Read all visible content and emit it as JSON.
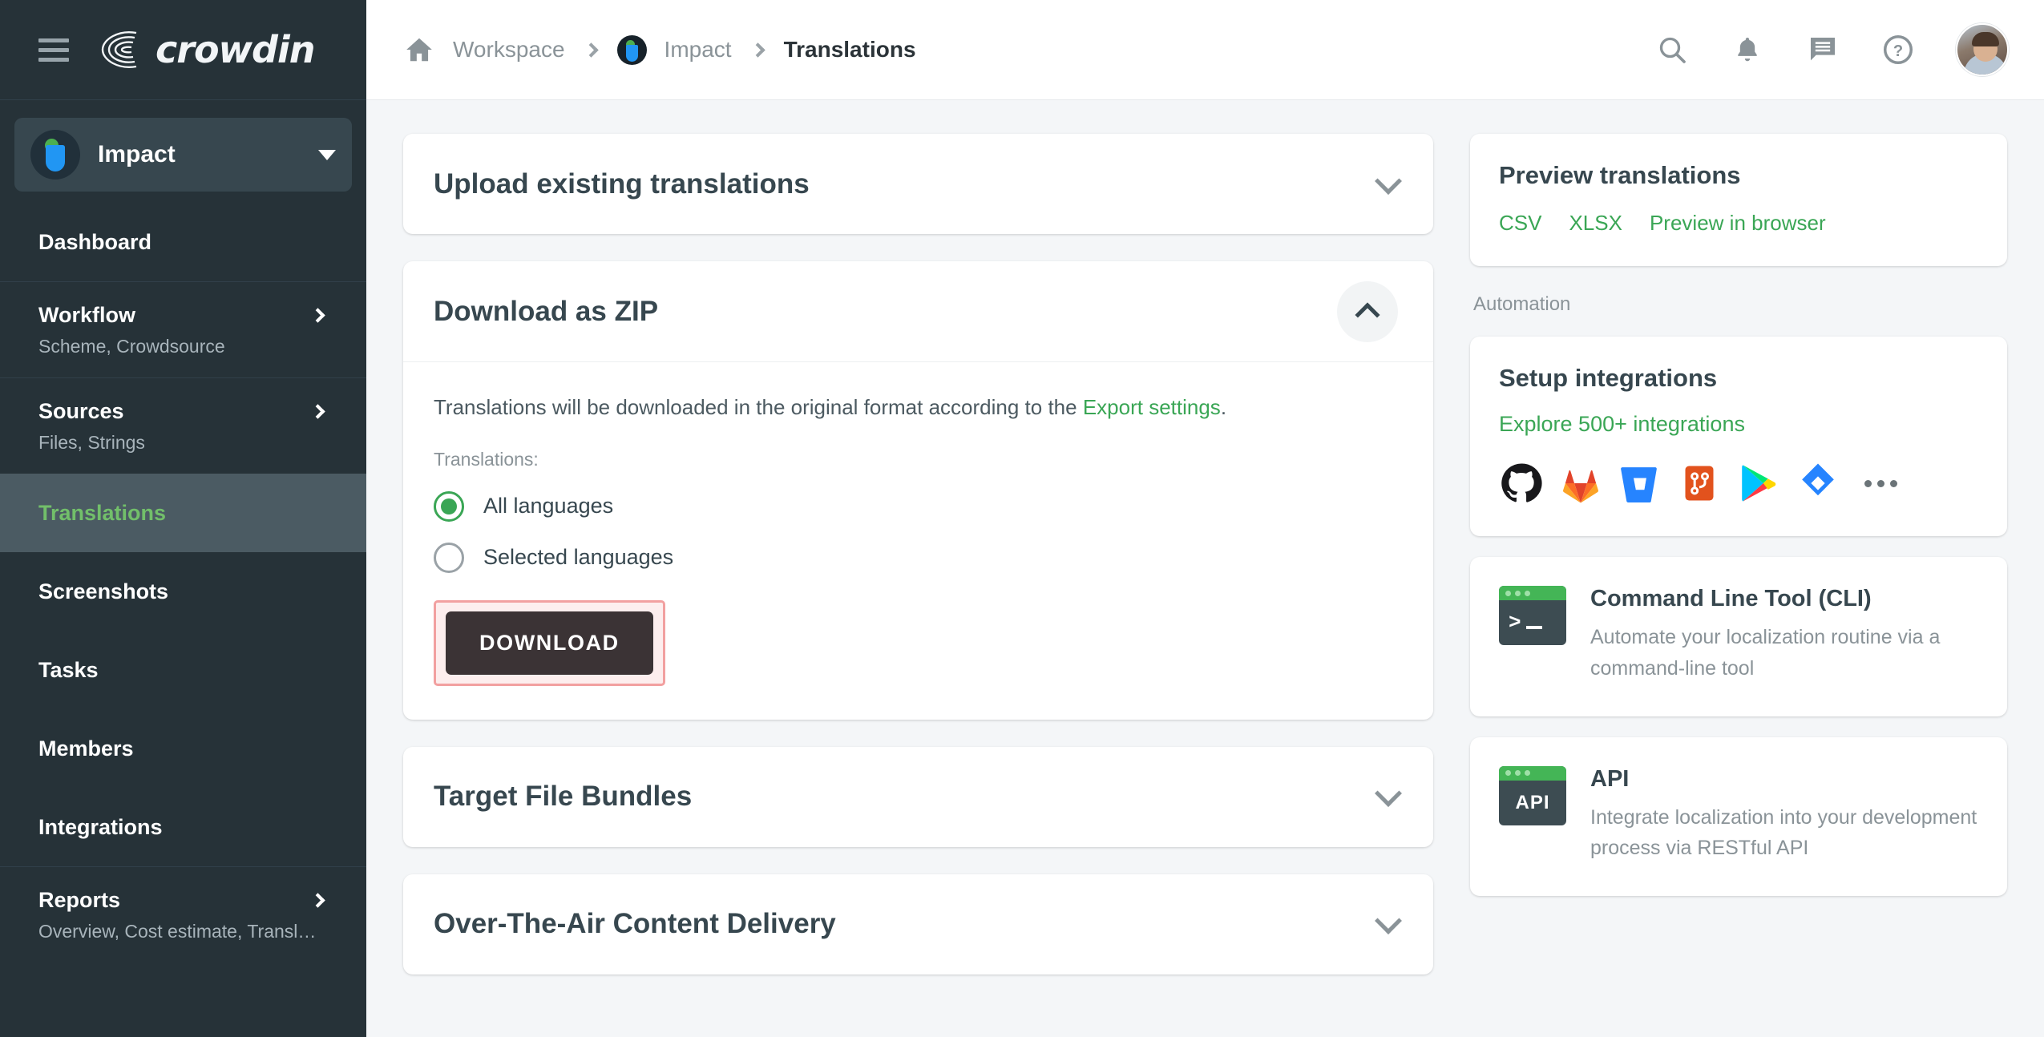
{
  "sidebar": {
    "brand": "crowdin",
    "project": {
      "name": "Impact"
    },
    "items": [
      {
        "label": "Dashboard",
        "sub": "",
        "chevron": false,
        "active": false,
        "divided": false
      },
      {
        "label": "Workflow",
        "sub": "Scheme, Crowdsource",
        "chevron": true,
        "active": false,
        "divided": true
      },
      {
        "label": "Sources",
        "sub": "Files, Strings",
        "chevron": true,
        "active": false,
        "divided": true
      },
      {
        "label": "Translations",
        "sub": "",
        "chevron": false,
        "active": true,
        "divided": false
      },
      {
        "label": "Screenshots",
        "sub": "",
        "chevron": false,
        "active": false,
        "divided": false
      },
      {
        "label": "Tasks",
        "sub": "",
        "chevron": false,
        "active": false,
        "divided": false
      },
      {
        "label": "Members",
        "sub": "",
        "chevron": false,
        "active": false,
        "divided": false
      },
      {
        "label": "Integrations",
        "sub": "",
        "chevron": false,
        "active": false,
        "divided": false
      },
      {
        "label": "Reports",
        "sub": "Overview, Cost estimate, Transl…",
        "chevron": true,
        "active": false,
        "divided": true
      }
    ]
  },
  "topbar": {
    "breadcrumb": {
      "home": "home-icon",
      "workspace": "Workspace",
      "project": "Impact",
      "current": "Translations"
    },
    "icons": [
      "search-icon",
      "bell-icon",
      "chat-icon",
      "help-icon",
      "avatar"
    ]
  },
  "main": {
    "upload_panel": {
      "title": "Upload existing translations",
      "expanded": false
    },
    "download_panel": {
      "title": "Download as ZIP",
      "expanded": true,
      "description_prefix": "Translations will be downloaded in the original format according to the ",
      "description_link": "Export settings",
      "description_suffix": ".",
      "field_label": "Translations:",
      "options": [
        {
          "label": "All languages",
          "selected": true
        },
        {
          "label": "Selected languages",
          "selected": false
        }
      ],
      "download_button": "DOWNLOAD",
      "highlight_color": "#f2a0a0"
    },
    "bundles_panel": {
      "title": "Target File Bundles",
      "expanded": false
    },
    "ota_panel": {
      "title": "Over-The-Air Content Delivery",
      "expanded": false
    }
  },
  "right": {
    "preview": {
      "title": "Preview translations",
      "links": [
        "CSV",
        "XLSX",
        "Preview in browser"
      ]
    },
    "automation_label": "Automation",
    "integrations": {
      "title": "Setup integrations",
      "link": "Explore 500+ integrations",
      "icons": [
        "github-icon",
        "gitlab-icon",
        "bitbucket-icon",
        "azure-repos-icon",
        "google-play-icon",
        "jira-icon",
        "more-icon"
      ]
    },
    "cli": {
      "icon_label": ">_",
      "title": "Command Line Tool (CLI)",
      "desc": "Automate your localization routine via a command-line tool"
    },
    "api": {
      "icon_label": "API",
      "title": "API",
      "desc": "Integrate localization into your development process via RESTful API"
    }
  },
  "colors": {
    "sidebar_bg": "#263238",
    "sidebar_active": "#4b5b63",
    "accent_green": "#3aa655",
    "active_green": "#72bf6a",
    "page_bg": "#f4f6f8",
    "dark_button": "#3b3335"
  }
}
